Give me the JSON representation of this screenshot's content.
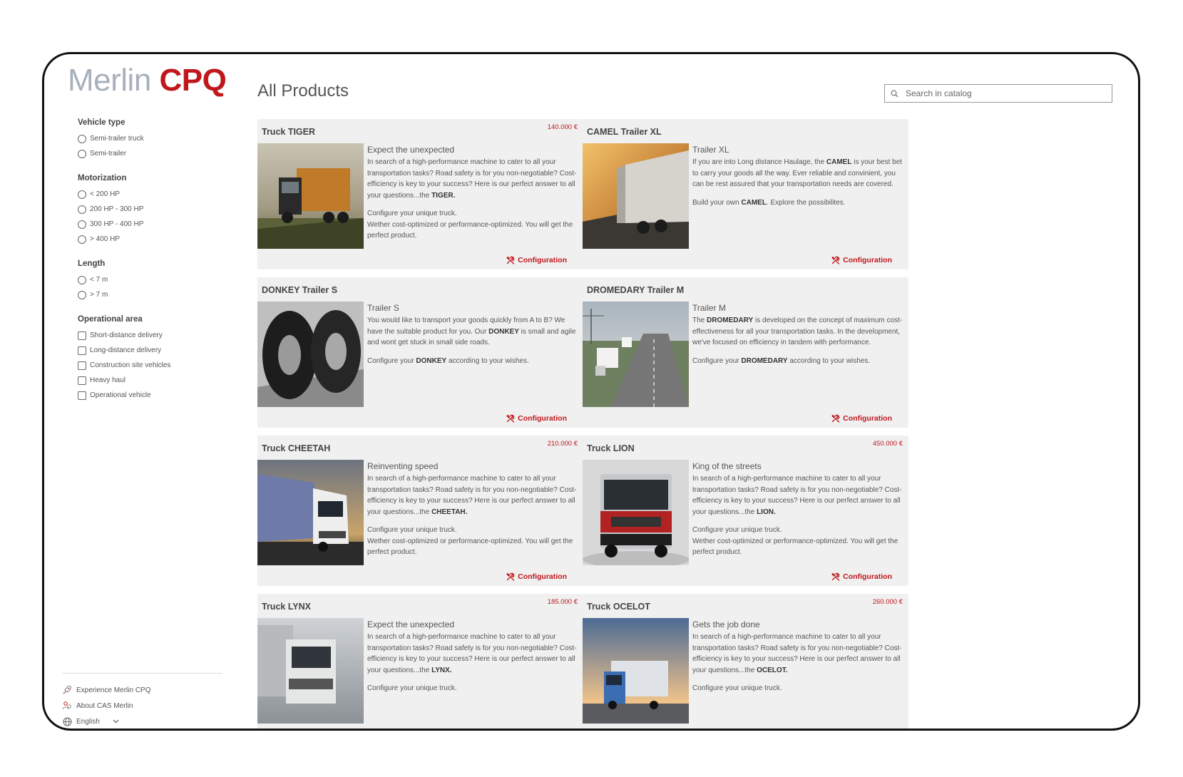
{
  "brand": {
    "name_part1": "Merlin",
    "name_part2": "CPQ"
  },
  "page": {
    "title": "All Products"
  },
  "search": {
    "placeholder": "Search in catalog"
  },
  "filters": [
    {
      "title": "Vehicle type",
      "type": "radio",
      "options": [
        "Semi-trailer truck",
        "Semi-trailer"
      ]
    },
    {
      "title": "Motorization",
      "type": "radio",
      "options": [
        "< 200 HP",
        "200 HP - 300 HP",
        "300 HP - 400 HP",
        "> 400 HP"
      ]
    },
    {
      "title": "Length",
      "type": "radio",
      "options": [
        "< 7 m",
        "> 7 m"
      ]
    },
    {
      "title": "Operational area",
      "type": "checkbox",
      "options": [
        "Short-distance delivery",
        "Long-distance delivery",
        "Construction site vehicles",
        "Heavy haul",
        "Operational vehicle"
      ]
    }
  ],
  "sidebar_footer": {
    "experience": "Experience Merlin CPQ",
    "about": "About CAS Merlin",
    "language": "English"
  },
  "config_label": "Configuration",
  "products": [
    {
      "title": "Truck TIGER",
      "price": "140.000 €",
      "subtitle": "Expect the unexpected",
      "paragraphs": [
        [
          {
            "t": "In search of a high-performance machine to cater to all your transportation tasks? Road safety is for you non-negotiable? Cost-efficiency is key to your success? Here is our perfect answer to all your questions...the "
          },
          {
            "t": "TIGER.",
            "b": true
          }
        ],
        [
          {
            "t": "Configure your unique truck."
          },
          {
            "br": true
          },
          {
            "t": "Wether cost-optimized or performance-optimized. You will get the perfect product."
          }
        ]
      ]
    },
    {
      "title": "CAMEL Trailer XL",
      "price": "",
      "subtitle": "Trailer XL",
      "paragraphs": [
        [
          {
            "t": "If you are into Long distance Haulage, the "
          },
          {
            "t": "CAMEL",
            "b": true
          },
          {
            "t": " is your best bet to carry your goods all the way. Ever reliable and convinient, you can be rest assured that your transportation needs are covered."
          }
        ],
        [
          {
            "t": "Build your own "
          },
          {
            "t": "CAMEL",
            "b": true
          },
          {
            "t": ". Explore the possibilites."
          }
        ]
      ]
    },
    {
      "title": "DONKEY Trailer S",
      "price": "",
      "subtitle": "Trailer S",
      "paragraphs": [
        [
          {
            "t": "You would like to transport your goods quickly from A to B?  We have the suitable product for you.  Our "
          },
          {
            "t": "DONKEY",
            "b": true
          },
          {
            "t": " is small and agile and wont get stuck in small side roads."
          }
        ],
        [
          {
            "t": "Configure your "
          },
          {
            "t": "DONKEY",
            "b": true
          },
          {
            "t": " according to your wishes."
          }
        ]
      ]
    },
    {
      "title": "DROMEDARY Trailer M",
      "price": "",
      "subtitle": "Trailer M",
      "paragraphs": [
        [
          {
            "t": "The "
          },
          {
            "t": "DROMEDARY",
            "b": true
          },
          {
            "t": " is developed on the concept of maximum cost-effectiveness for all your transportation tasks. In the development, we've focused on efficiency in tandem with performance."
          }
        ],
        [
          {
            "t": "Configure your "
          },
          {
            "t": "DROMEDARY",
            "b": true
          },
          {
            "t": " according to your wishes."
          }
        ]
      ]
    },
    {
      "title": "Truck CHEETAH",
      "price": "210.000 €",
      "subtitle": "Reinventing speed",
      "paragraphs": [
        [
          {
            "t": "In search of a high-performance machine to cater to all your transportation tasks? Road safety is for you non-negotiable? Cost-efficiency is key to your success? Here is our perfect answer to all your questions...the "
          },
          {
            "t": "CHEETAH.",
            "b": true
          }
        ],
        [
          {
            "t": "Configure your unique truck."
          },
          {
            "br": true
          },
          {
            "t": "Wether cost-optimized or performance-optimized. You will get the perfect product."
          }
        ]
      ]
    },
    {
      "title": "Truck LION",
      "price": "450.000 €",
      "subtitle": "King of the streets",
      "paragraphs": [
        [
          {
            "t": "In search of a high-performance machine to cater to all your transportation tasks? Road safety is for you non-negotiable? Cost-efficiency is key to your success? Here is our perfect answer to all your questions...the "
          },
          {
            "t": "LION.",
            "b": true
          }
        ],
        [
          {
            "t": "Configure your unique truck."
          },
          {
            "br": true
          },
          {
            "t": "Wether cost-optimized or performance-optimized. You will get the perfect product."
          }
        ]
      ]
    },
    {
      "title": "Truck LYNX",
      "price": "185.000 €",
      "subtitle": "Expect the unexpected",
      "paragraphs": [
        [
          {
            "t": "In search of a high-performance machine to cater to all your transportation tasks? Road safety is for you non-negotiable? Cost-efficiency is key to your success? Here is our perfect answer to all your questions...the "
          },
          {
            "t": "LYNX.",
            "b": true
          }
        ],
        [
          {
            "t": "Configure your unique truck."
          }
        ]
      ]
    },
    {
      "title": "Truck OCELOT",
      "price": "260.000 €",
      "subtitle": "Gets the job done",
      "paragraphs": [
        [
          {
            "t": "In search of a high-performance machine to cater to all your transportation tasks? Road safety is for you non-negotiable? Cost-efficiency is key to your success? Here is our perfect answer to all your questions...the "
          },
          {
            "t": "OCELOT.",
            "b": true
          }
        ],
        [
          {
            "t": "Configure your unique truck."
          }
        ]
      ]
    }
  ],
  "colors": {
    "brand_red": "#c0171c",
    "brand_grey": "#a7b0bb",
    "card_bg": "#f0f0f0"
  }
}
